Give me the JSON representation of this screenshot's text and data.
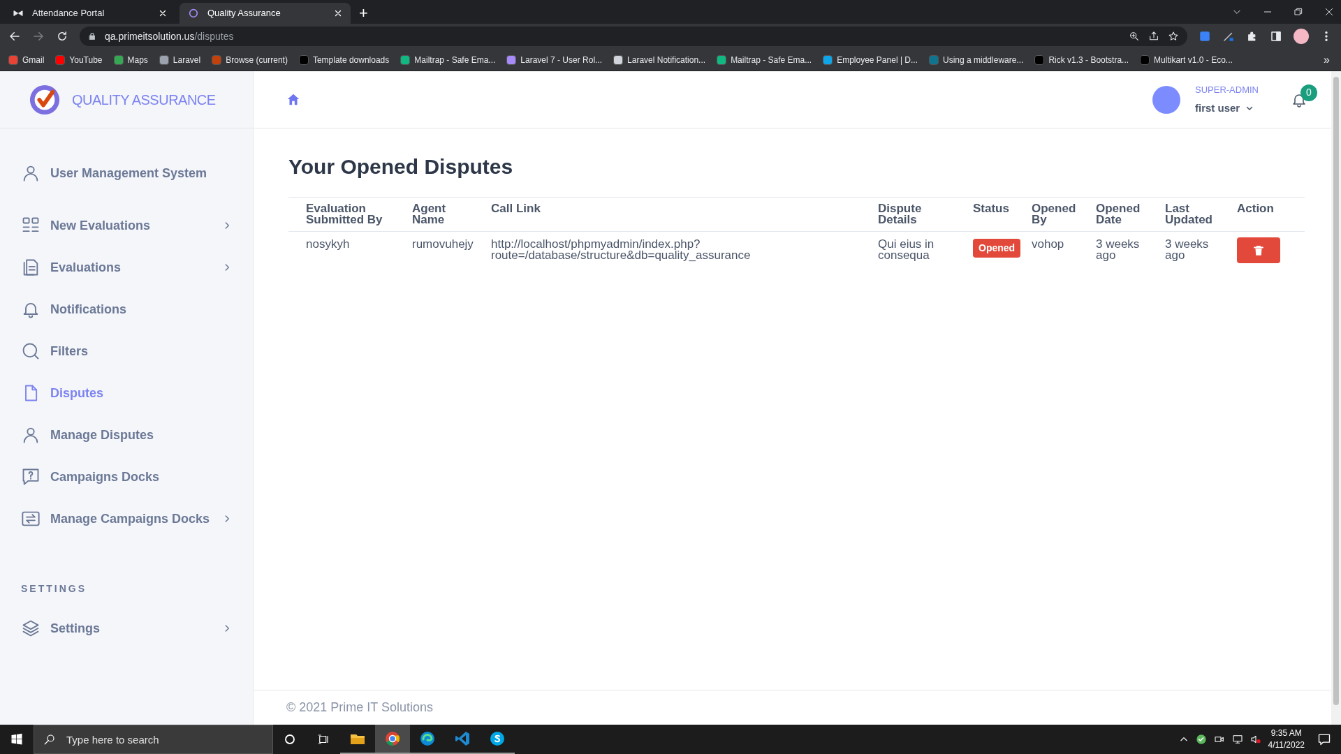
{
  "browser": {
    "tabs": [
      {
        "title": "Attendance Portal",
        "selected": false
      },
      {
        "title": "Quality Assurance",
        "selected": true
      }
    ],
    "new_tab": "+",
    "address": {
      "host": "qa.primeitsolution.us",
      "path": "/disputes"
    },
    "bookmarks": [
      "Gmail",
      "YouTube",
      "Maps",
      "Laravel",
      "Browse (current)",
      "Template downloads",
      "Mailtrap - Safe Ema...",
      "Laravel 7 - User Rol...",
      "Laravel Notification...",
      "Mailtrap - Safe Ema...",
      "Employee Panel | D...",
      "Using a middleware...",
      "Rick v1.3 - Bootstra...",
      "Multikart v1.0 - Eco..."
    ],
    "more_bookmarks": "»"
  },
  "sidebar": {
    "logo_text": "QUALITY ASSURANCE",
    "items": [
      {
        "label": "User Management System",
        "expandable": false,
        "selected": false
      },
      {
        "label": "New Evaluations",
        "expandable": true,
        "selected": false
      },
      {
        "label": "Evaluations",
        "expandable": true,
        "selected": false
      },
      {
        "label": "Notifications",
        "expandable": false,
        "selected": false
      },
      {
        "label": "Filters",
        "expandable": false,
        "selected": false
      },
      {
        "label": "Disputes",
        "expandable": false,
        "selected": true
      },
      {
        "label": "Manage Disputes",
        "expandable": false,
        "selected": false
      },
      {
        "label": "Campaigns Docks",
        "expandable": false,
        "selected": false
      },
      {
        "label": "Manage Campaigns Docks",
        "expandable": true,
        "selected": false
      }
    ],
    "section_title": "SETTINGS",
    "settings_items": [
      {
        "label": "Settings",
        "expandable": true,
        "selected": false
      }
    ]
  },
  "header": {
    "role": "SUPER-ADMIN",
    "user": "first user",
    "notification_count": "0"
  },
  "page_title": "Your Opened Disputes",
  "table": {
    "columns": [
      "Evaluation Submitted By",
      "Agent Name",
      "Call Link",
      "Dispute Details",
      "Status",
      "Opened By",
      "Opened Date",
      "Last Updated",
      "Action"
    ],
    "rows": [
      {
        "cells": [
          {
            "kind": "text",
            "text": "nosykyh"
          },
          {
            "kind": "text",
            "text": "rumovuhejy"
          },
          {
            "kind": "text",
            "text": "http://localhost/phpmyadmin/index.php?route=/database/structure&db=quality_assurance"
          },
          {
            "kind": "text",
            "text": "Qui eius in consequa"
          },
          {
            "kind": "badge",
            "text": "Opened"
          },
          {
            "kind": "text",
            "text": "vohop"
          },
          {
            "kind": "text",
            "text": "3 weeks ago"
          },
          {
            "kind": "text",
            "text": "3 weeks ago"
          },
          {
            "kind": "delete"
          }
        ]
      }
    ]
  },
  "footer": "© 2021 Prime IT Solutions",
  "taskbar": {
    "search_placeholder": "Type here to search",
    "apps": [
      {
        "kind": "explorer",
        "selected": false
      },
      {
        "kind": "chrome",
        "selected": true
      },
      {
        "kind": "edge",
        "selected": false
      },
      {
        "kind": "vscode",
        "selected": false
      },
      {
        "kind": "skype",
        "selected": false
      }
    ],
    "time": "9:35 AM",
    "date": "4/11/2022"
  }
}
